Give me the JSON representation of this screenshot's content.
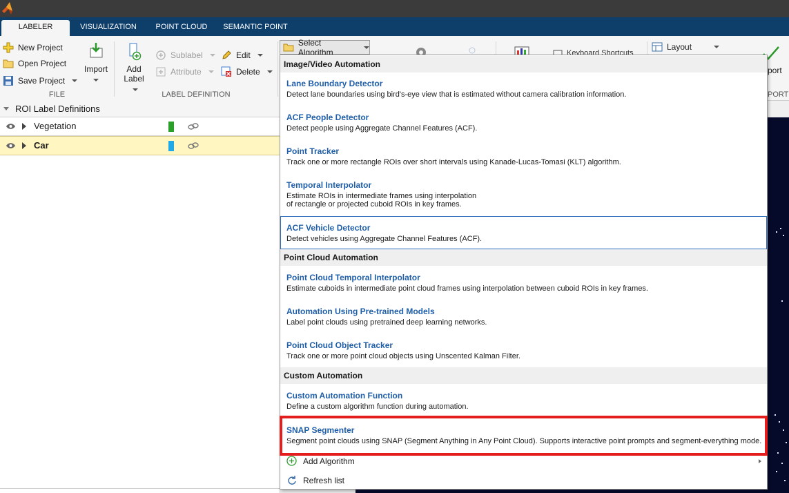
{
  "tabs": [
    "LABELER",
    "VISUALIZATION",
    "POINT CLOUD",
    "SEMANTIC POINT"
  ],
  "file": {
    "new_project": "New Project",
    "open_project": "Open Project",
    "save_project": "Save Project",
    "import": "Import",
    "section": "FILE"
  },
  "label_def": {
    "add": "Add",
    "label": "Label",
    "sublabel": "Sublabel",
    "attribute": "Attribute",
    "edit": "Edit",
    "delete": "Delete",
    "section": "LABEL DEFINITION"
  },
  "toolbar": {
    "select_algorithm": "Select Algorithm",
    "layout": "Layout",
    "keyboard_shortcuts": "Keyboard Shortcuts",
    "export_partial": "port",
    "export_section_partial": "PORT"
  },
  "roi": {
    "header": "ROI Label Definitions",
    "labels": [
      {
        "name": "Vegetation",
        "color": "#2aa02a"
      },
      {
        "name": "Car",
        "color": "#1fa9e8"
      }
    ]
  },
  "dropdown": {
    "groups": {
      "image_video": "Image/Video Automation",
      "point_cloud": "Point Cloud Automation",
      "custom": "Custom Automation"
    },
    "algorithms": [
      {
        "name": "Lane Boundary Detector",
        "desc": "Detect lane boundaries using bird's-eye view that is estimated without camera calibration information."
      },
      {
        "name": "ACF People Detector",
        "desc": "Detect people using Aggregate Channel Features (ACF)."
      },
      {
        "name": "Point Tracker",
        "desc": "Track one or more rectangle ROIs over short intervals using Kanade-Lucas-Tomasi (KLT) algorithm."
      },
      {
        "name": "Temporal Interpolator",
        "desc": "Estimate ROIs in intermediate frames using interpolation",
        "desc2": "of rectangle or projected cuboid ROIs in key frames."
      },
      {
        "name": "ACF Vehicle Detector",
        "desc": "Detect vehicles using Aggregate Channel Features (ACF)."
      },
      {
        "name": "Point Cloud Temporal Interpolator",
        "desc": "Estimate cuboids in intermediate point cloud frames using interpolation between cuboid ROIs in key frames."
      },
      {
        "name": "Automation Using Pre-trained Models",
        "desc": "Label point clouds using pretrained deep learning networks."
      },
      {
        "name": "Point Cloud Object Tracker",
        "desc": "Track one or more point cloud objects using Unscented Kalman Filter."
      },
      {
        "name": "Custom Automation Function",
        "desc": "Define a custom algorithm function during automation."
      },
      {
        "name": "SNAP Segmenter",
        "desc": "Segment point clouds using SNAP (Segment Anything in Any Point Cloud). Supports interactive point prompts and segment-everything mode."
      }
    ],
    "add_algorithm": "Add Algorithm",
    "refresh_list": "Refresh list"
  }
}
